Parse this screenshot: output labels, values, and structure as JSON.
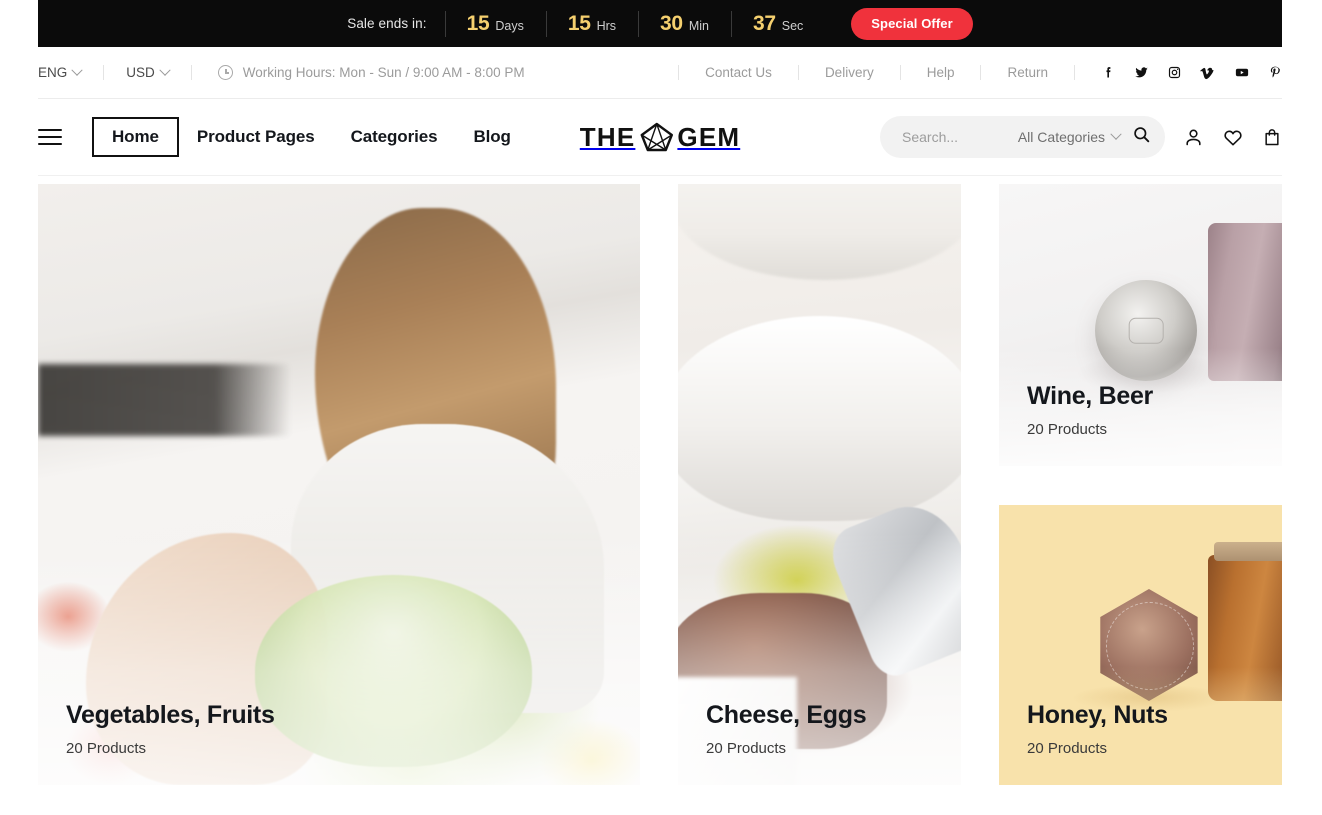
{
  "sale_bar": {
    "label": "Sale ends in:",
    "units": [
      {
        "value": "15",
        "name": "Days"
      },
      {
        "value": "15",
        "name": "Hrs"
      },
      {
        "value": "30",
        "name": "Min"
      },
      {
        "value": "37",
        "name": "Sec"
      }
    ],
    "cta": "Special Offer",
    "cta_color": "#f0323c",
    "number_color": "#f5d06f",
    "background": "#0b0b0b"
  },
  "utility_bar": {
    "language": "ENG",
    "currency": "USD",
    "working_hours": "Working Hours: Mon - Sun / 9:00 AM - 8:00 PM",
    "links": [
      "Contact Us",
      "Delivery",
      "Help",
      "Return"
    ],
    "socials": [
      "facebook-icon",
      "twitter-icon",
      "instagram-icon",
      "vimeo-icon",
      "youtube-icon",
      "pinterest-icon"
    ]
  },
  "nav": {
    "menu_icon": "hamburger-icon",
    "items": [
      {
        "label": "Home",
        "active": true
      },
      {
        "label": "Product Pages",
        "active": false
      },
      {
        "label": "Categories",
        "active": false
      },
      {
        "label": "Blog",
        "active": false
      }
    ],
    "logo": {
      "left": "THE",
      "right": "GEM",
      "icon": "gem-icon"
    },
    "search": {
      "placeholder": "Search...",
      "value": "",
      "categories_label": "All Categories",
      "search_icon": "search-icon"
    },
    "actions": [
      "account-icon",
      "wishlist-heart-icon",
      "cart-bag-icon"
    ]
  },
  "categories": [
    {
      "title": "Vegetables, Fruits",
      "count": "20 Products"
    },
    {
      "title": "Cheese, Eggs",
      "count": "20 Products"
    },
    {
      "title": "Wine, Beer",
      "count": "20 Products"
    },
    {
      "title": "Honey, Nuts",
      "count": "20 Products"
    }
  ]
}
